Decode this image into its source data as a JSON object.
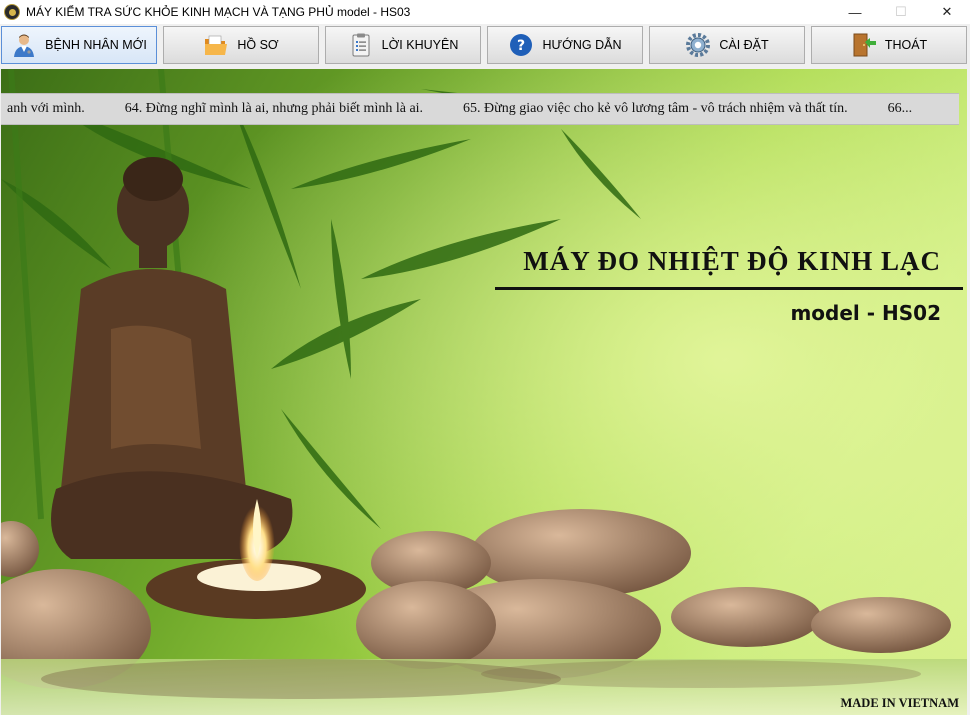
{
  "window": {
    "title": "MÁY KIỂM TRA SỨC KHỎE KINH MẠCH VÀ TẠNG PHỦ   model - HS03",
    "minimize": "—",
    "maximize": "☐",
    "close": "✕"
  },
  "toolbar": {
    "buttons": [
      {
        "label": "BỆNH NHÂN MỚI",
        "icon": "doctor-icon"
      },
      {
        "label": "HỒ SƠ",
        "icon": "folder-icon"
      },
      {
        "label": "LỜI KHUYÊN",
        "icon": "clipboard-icon"
      },
      {
        "label": "HƯỚNG DẪN",
        "icon": "help-icon"
      },
      {
        "label": "CÀI ĐẶT",
        "icon": "gear-icon"
      },
      {
        "label": "THOÁT",
        "icon": "exit-door-icon"
      }
    ]
  },
  "ticker": {
    "items": [
      "anh với mình.",
      "64. Đừng nghĩ mình là ai, nhưng phải biết mình là ai.",
      "65. Đừng giao việc cho kẻ vô lương tâm - vô trách nhiệm và thất tín.",
      "66..."
    ]
  },
  "banner": {
    "heading": "MÁY ĐO NHIỆT ĐỘ KINH LẠC",
    "model": "model - HS02",
    "footer": "MADE IN VIETNAM"
  },
  "colors": {
    "accent_border": "#5b8fd8",
    "background_green": "#a7d84a",
    "help_blue": "#1f5fb8",
    "exit_green": "#3fae3a",
    "folder_orange": "#f2a23a"
  }
}
